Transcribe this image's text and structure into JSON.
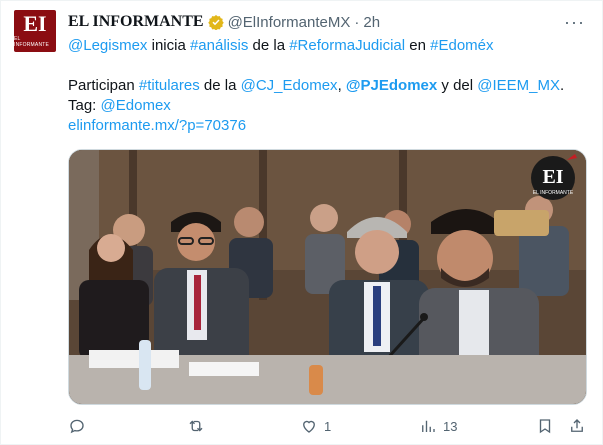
{
  "tweet": {
    "avatar_text": "EI",
    "avatar_subtext": "EL INFORMANTE",
    "author_name": "EL INFORMANTE",
    "handle": "@ElInformanteMX",
    "separator": "·",
    "time": "2h",
    "more": "···",
    "line1": {
      "mention1": "@Legismex",
      "t1": " inicia ",
      "hashtag1": "#análisis",
      "t2": " de la ",
      "hashtag2": "#ReformaJudicial",
      "t3": " en ",
      "hashtag3": "#Edoméx"
    },
    "line2": {
      "t1": "Participan ",
      "hashtag1": "#titulares",
      "t2": " de la ",
      "mention1": "@CJ_Edomex",
      "t3": ", ",
      "mention2": "@PJEdomex",
      "t4": " y del ",
      "mention3": "@IEEM_MX",
      "t5": "."
    },
    "line3": {
      "t1": "Tag: ",
      "mention1": "@Edomex"
    },
    "line4": {
      "link": "elinformante.mx/?p=70376"
    },
    "media_logo_text": "EI",
    "media_logo_subtext": "EL INFORMANTE",
    "actions": {
      "reply_count": "",
      "retweet_count": "",
      "like_count": "1",
      "views_count": "13"
    }
  },
  "colors": {
    "accent": "#1d9bf0",
    "muted": "#536471",
    "brand": "#8b0d12",
    "verified": "#e2b719"
  }
}
